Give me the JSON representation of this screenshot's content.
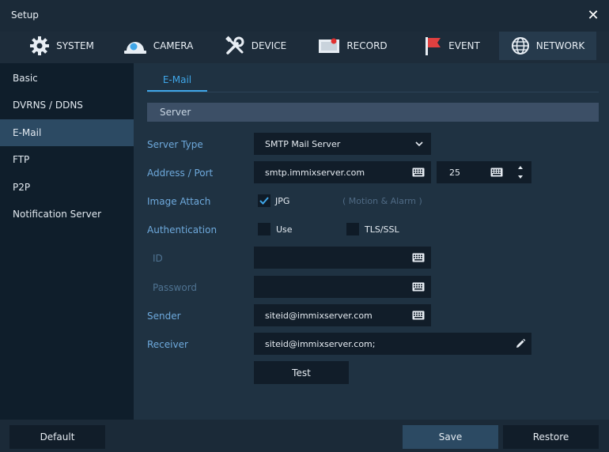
{
  "window": {
    "title": "Setup",
    "close_icon": "close-icon"
  },
  "tabs": [
    {
      "label": "SYSTEM",
      "icon": "gear-icon"
    },
    {
      "label": "CAMERA",
      "icon": "camera-dome-icon"
    },
    {
      "label": "DEVICE",
      "icon": "tools-icon"
    },
    {
      "label": "RECORD",
      "icon": "record-icon"
    },
    {
      "label": "EVENT",
      "icon": "flag-icon"
    },
    {
      "label": "NETWORK",
      "icon": "globe-icon",
      "active": true
    }
  ],
  "sidebar": {
    "items": [
      {
        "label": "Basic"
      },
      {
        "label": "DVRNS / DDNS"
      },
      {
        "label": "E-Mail",
        "active": true
      },
      {
        "label": "FTP"
      },
      {
        "label": "P2P"
      },
      {
        "label": "Notification Server"
      }
    ]
  },
  "subtab": {
    "label": "E-Mail"
  },
  "section": {
    "title": "Server"
  },
  "form": {
    "server_type": {
      "label": "Server Type",
      "value": "SMTP Mail Server"
    },
    "address_port": {
      "label": "Address / Port",
      "address": "smtp.immixserver.com",
      "port": "25"
    },
    "image_attach": {
      "label": "Image Attach",
      "option": "JPG",
      "checked": true,
      "hint": "( Motion & Alarm )"
    },
    "authentication": {
      "label": "Authentication",
      "use_label": "Use",
      "use_checked": false,
      "tls_label": "TLS/SSL",
      "tls_checked": false
    },
    "id": {
      "label": "ID",
      "value": ""
    },
    "password": {
      "label": "Password",
      "value": ""
    },
    "sender": {
      "label": "Sender",
      "value": "siteid@immixserver.com"
    },
    "receiver": {
      "label": "Receiver",
      "value": "siteid@immixserver.com;"
    },
    "test_label": "Test"
  },
  "footer": {
    "default_label": "Default",
    "save_label": "Save",
    "restore_label": "Restore"
  },
  "colors": {
    "accent": "#3fa6e8",
    "label": "#6ea9dc",
    "active_tab": "#263a4c",
    "active_side": "#2c4a63"
  }
}
